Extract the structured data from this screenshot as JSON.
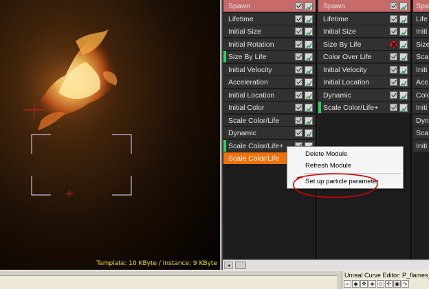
{
  "viewport": {
    "stats": "Template: 10 KByte / Instance: 9 KByte"
  },
  "emitters": [
    {
      "modules": [
        {
          "label": "Spawn",
          "type": "spawn"
        },
        {
          "label": "Lifetime"
        },
        {
          "label": "Initial Size"
        },
        {
          "label": "Initial Rotation"
        },
        {
          "label": "Size By Life",
          "marker": true
        },
        {
          "label": "Initial Velocity"
        },
        {
          "label": "Acceleration"
        },
        {
          "label": "Initial Location"
        },
        {
          "label": "Initial Color"
        },
        {
          "label": "Scale Color/Life"
        },
        {
          "label": "Dynamic"
        },
        {
          "label": "Scale Color/Life+",
          "marker": true
        },
        {
          "label": "Scale Color/Life",
          "type": "selected"
        }
      ]
    },
    {
      "modules": [
        {
          "label": "Spawn",
          "type": "spawn"
        },
        {
          "label": "Lifetime"
        },
        {
          "label": "Initial Size"
        },
        {
          "label": "Size By Life",
          "disabled": true
        },
        {
          "label": "Color Over Life"
        },
        {
          "label": "Initial Velocity"
        },
        {
          "label": "Initial Location"
        },
        {
          "label": "Dynamic"
        },
        {
          "label": "Scale Color/Life+",
          "marker": true
        }
      ]
    },
    {
      "modules": [
        {
          "label": "Spa",
          "type": "spawn"
        },
        {
          "label": "Life"
        },
        {
          "label": "Initi"
        },
        {
          "label": "Size"
        },
        {
          "label": "Sca"
        },
        {
          "label": "Initi"
        },
        {
          "label": "Acc"
        },
        {
          "label": "Colo"
        },
        {
          "label": "Initi"
        },
        {
          "label": "Dyn"
        },
        {
          "label": "Sca"
        },
        {
          "label": "Initi"
        }
      ]
    }
  ],
  "context_menu": {
    "delete": "Delete Module",
    "refresh": "Refresh Module",
    "setup": "Set up particle parameter"
  },
  "curve_editor": {
    "title": "Unreal Curve Editor: P_flames_blo"
  },
  "colors": {
    "spawn": "#c66a6a",
    "selected": "#f0700c",
    "marker": "#2fd05f",
    "annotation": "#d40000",
    "stats_text": "#f2e600"
  }
}
